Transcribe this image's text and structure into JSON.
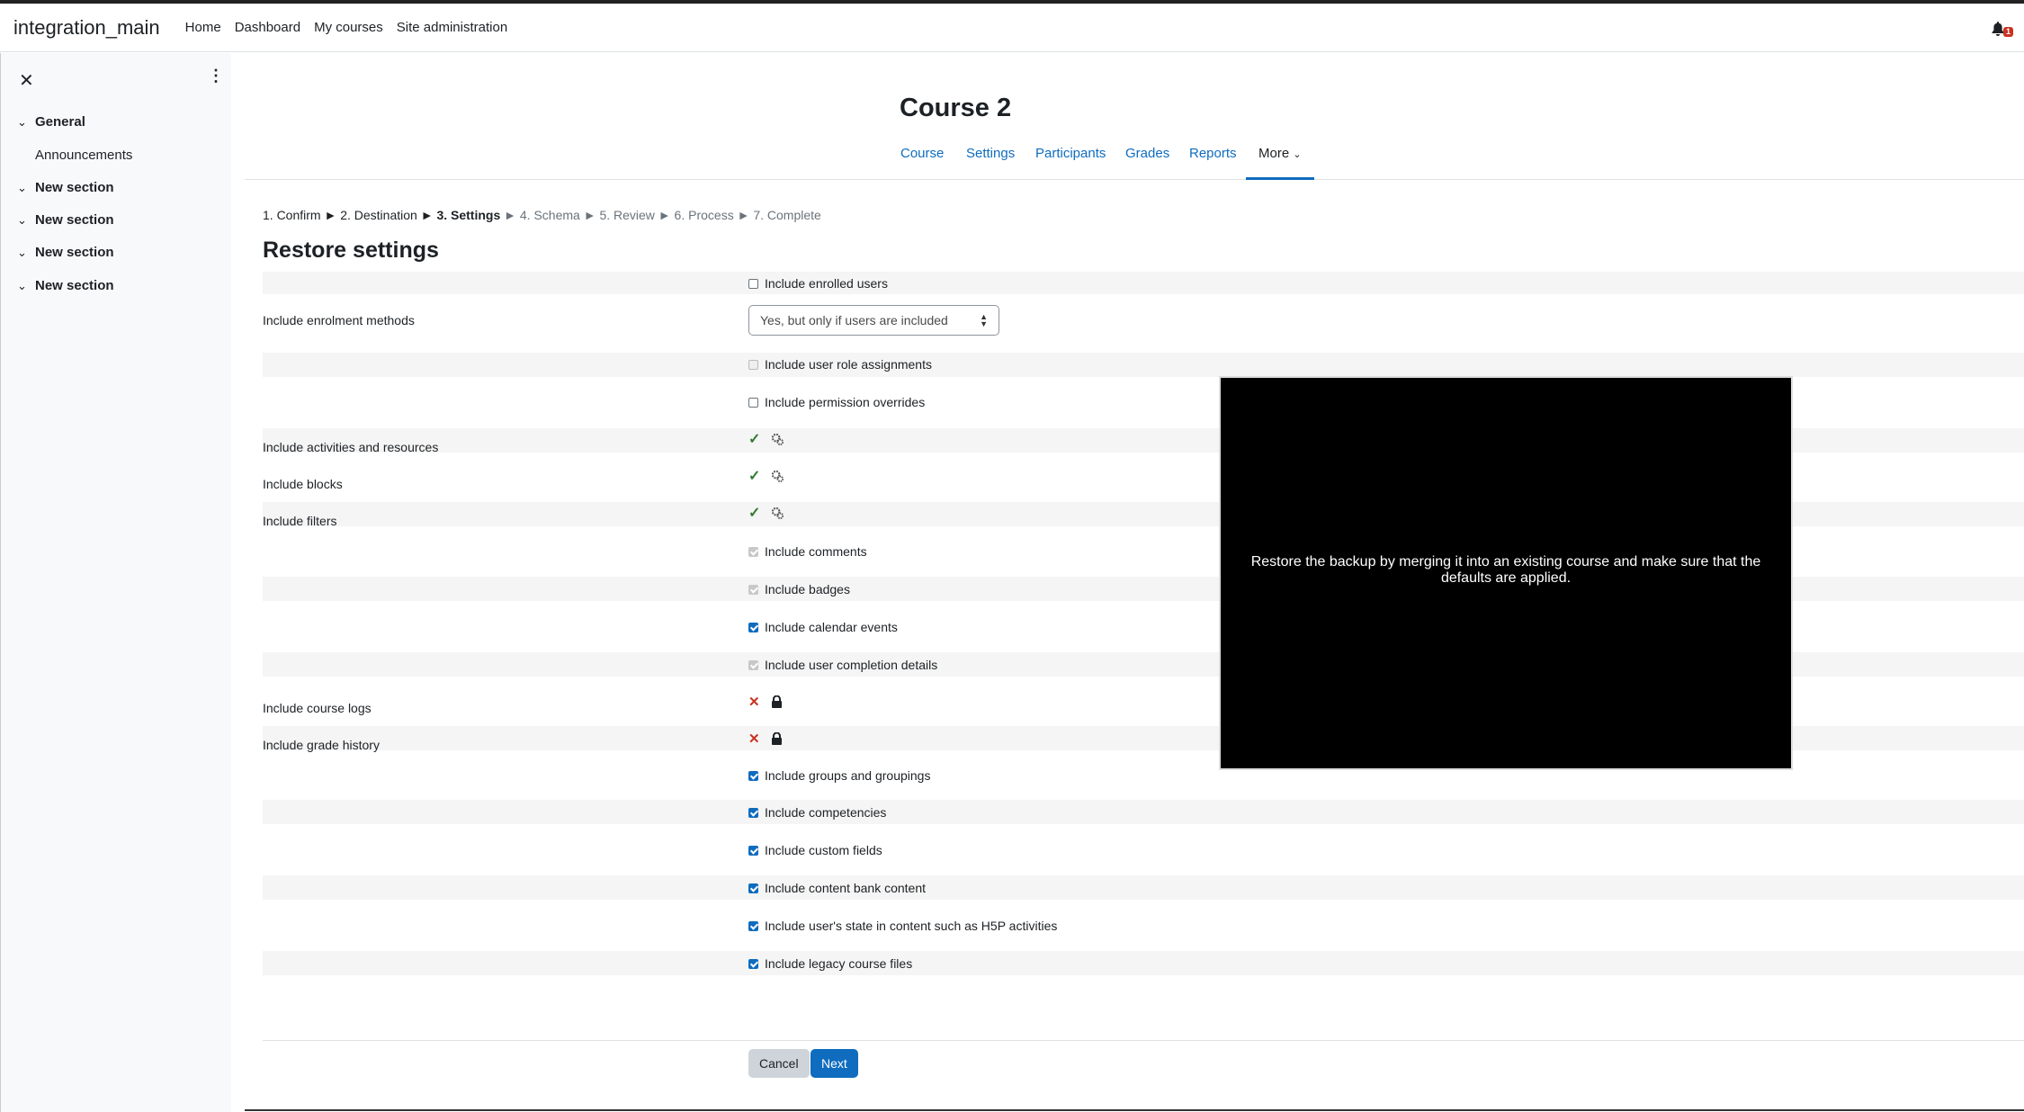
{
  "navbar": {
    "brand": "integration_main",
    "links": [
      "Home",
      "Dashboard",
      "My courses",
      "Site administration"
    ],
    "notification_count": "1"
  },
  "drawer": {
    "items": [
      {
        "label": "General",
        "kind": "section"
      },
      {
        "label": "Announcements",
        "kind": "activity"
      },
      {
        "label": "New section",
        "kind": "section"
      },
      {
        "label": "New section",
        "kind": "section"
      },
      {
        "label": "New section",
        "kind": "section"
      },
      {
        "label": "New section",
        "kind": "section"
      }
    ]
  },
  "course": {
    "title": "Course 2",
    "tabs": [
      "Course",
      "Settings",
      "Participants",
      "Grades",
      "Reports",
      "More"
    ]
  },
  "steps": {
    "done": "1. Confirm ► 2. Destination ►",
    "current": "3. Settings",
    "rest": "► 4. Schema ► 5. Review ► 6. Process ► 7. Complete"
  },
  "restore": {
    "heading": "Restore settings",
    "include_enrolled_users": "Include enrolled users",
    "enrolment_methods_label": "Include enrolment methods",
    "enrolment_methods_value": "Yes, but only if users are included",
    "role_assignments": "Include user role assignments",
    "permission_overrides": "Include permission overrides",
    "activities_label": "Include activities and resources",
    "blocks_label": "Include blocks",
    "filters_label": "Include filters",
    "comments": "Include comments",
    "badges": "Include badges",
    "calendar_events": "Include calendar events",
    "completion_details": "Include user completion details",
    "course_logs_label": "Include course logs",
    "grade_history_label": "Include grade history",
    "groups": "Include groups and groupings",
    "competencies": "Include competencies",
    "custom_fields": "Include custom fields",
    "content_bank": "Include content bank content",
    "h5p_state": "Include user's state in content such as H5P activities",
    "legacy_files": "Include legacy course files",
    "cancel": "Cancel",
    "next": "Next"
  },
  "overlay": {
    "text": "Restore the backup by merging it into an existing course and make sure that the defaults are applied."
  }
}
